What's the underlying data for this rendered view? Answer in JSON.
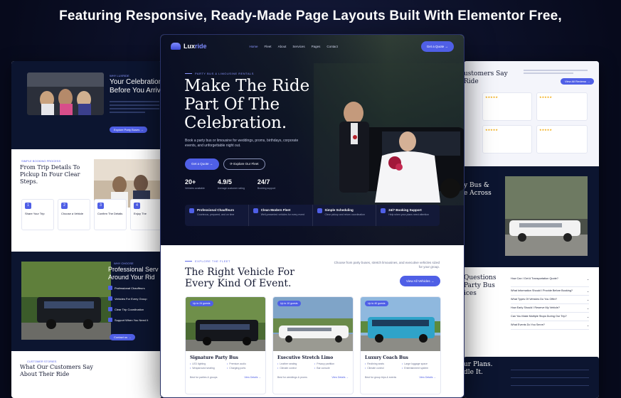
{
  "headline": "Featuring Responsive, Ready-Made Page Layouts Built With Elementor Free,",
  "brand": {
    "name_a": "Lux",
    "name_b": "ride"
  },
  "nav": {
    "items": [
      "Home",
      "Fleet",
      "About",
      "Services",
      "Pages",
      "Contact"
    ],
    "cta": "Get a Quote →"
  },
  "hero": {
    "eyebrow": "PARTY BUS & LIMOUSINE RENTALS",
    "title": "Make The Ride Part Of The Celebration.",
    "subtitle": "Book a party bus or limousine for weddings, proms, birthdays, corporate events, and unforgettable night out.",
    "btn_primary": "Get a Quote →",
    "btn_secondary": "⟳  Explore Our Fleet",
    "stats": [
      {
        "value": "20+",
        "label": "Vehicles available"
      },
      {
        "value": "4.9/5",
        "label": "Average customer rating"
      },
      {
        "value": "24/7",
        "label": "Booking support"
      }
    ],
    "features": [
      {
        "title": "Professional Chauffeurs",
        "desc": "Courteous, prepared, and on time"
      },
      {
        "title": "Clean Modern Fleet",
        "desc": "Well-presented vehicles for every event"
      },
      {
        "title": "Simple Scheduling",
        "desc": "Clear pickup and return coordination"
      },
      {
        "title": "24/7 Booking Support",
        "desc": "Help when your plans need attention"
      }
    ]
  },
  "fleet": {
    "eyebrow": "EXPLORE THE FLEET",
    "title": "The Right Vehicle For Every Kind Of Event.",
    "desc": "Choose from party buses, stretch limousines, and executive vehicles sized for your group.",
    "btn": "View All Vehicles →",
    "vehicles": [
      {
        "badge": "Up to 24 guests",
        "name": "Signature Party Bus",
        "feats": [
          "LED lighting",
          "Premium audio",
          "Wraparound seating",
          "Charging ports"
        ],
        "foot": "Best for parties & groups",
        "link": "View Details →"
      },
      {
        "badge": "Up to 10 guests",
        "name": "Executive Stretch Limo",
        "feats": [
          "Leather seating",
          "Privacy partition",
          "Climate control",
          "Bar console"
        ],
        "foot": "Best for weddings & proms",
        "link": "View Details →"
      },
      {
        "badge": "Up to 40 guests",
        "name": "Luxury Coach Bus",
        "feats": [
          "Reclining seats",
          "Large luggage space",
          "Climate control",
          "Entertainment system"
        ],
        "foot": "Best for group trips & events",
        "link": "View Details →"
      }
    ]
  },
  "left_preview": {
    "eyebrow": "WHY LUXRIDE",
    "title1": "Your Celebration",
    "title2": "Before You Arriv",
    "btn": "Explore Party Buses →",
    "steps_eyebrow": "SIMPLE BOOKING PROCESS",
    "steps_title": "From Trip Details To Pickup In Four Clear Steps.",
    "steps": [
      {
        "num": "1",
        "label": "Share Your Trip"
      },
      {
        "num": "2",
        "label": "Choose a Vehicle"
      },
      {
        "num": "3",
        "label": "Confirm The Details"
      },
      {
        "num": "4",
        "label": "Enjoy The"
      }
    ],
    "services_eyebrow": "WHY CHOOSE",
    "services_title1": "Professional Serv",
    "services_title2": "Around Your Rid",
    "services": [
      "Professional Chauffeurs",
      "Vehicles For Every Group",
      "Clear Trip Coordination",
      "Support When You Need It"
    ],
    "services_btn": "Contact us →",
    "reviews_eyebrow": "CUSTOMER STORIES",
    "reviews_title": "What Our Customers Say About Their Ride"
  },
  "right_preview": {
    "title1": "ustomers Say",
    "title2": "Ride",
    "btn": "View All Reviews →",
    "section2_title1": "y Bus &",
    "section2_title2": "e Across",
    "faq_title1": "Questions",
    "faq_title2": "Party Bus",
    "faq_title3": "ices",
    "faqs": [
      "How Can I Get A Transportation Quote?",
      "What Information Should I Provide Before Booking?",
      "What Types Of Vehicles Do You Offer?",
      "How Early Should I Reserve My Vehicle?",
      "Can You Make Multiple Stops During Our Trip?",
      "What Events Do You Serve?"
    ],
    "cta_title1": "ur Plans.",
    "cta_title2": "dle It."
  }
}
